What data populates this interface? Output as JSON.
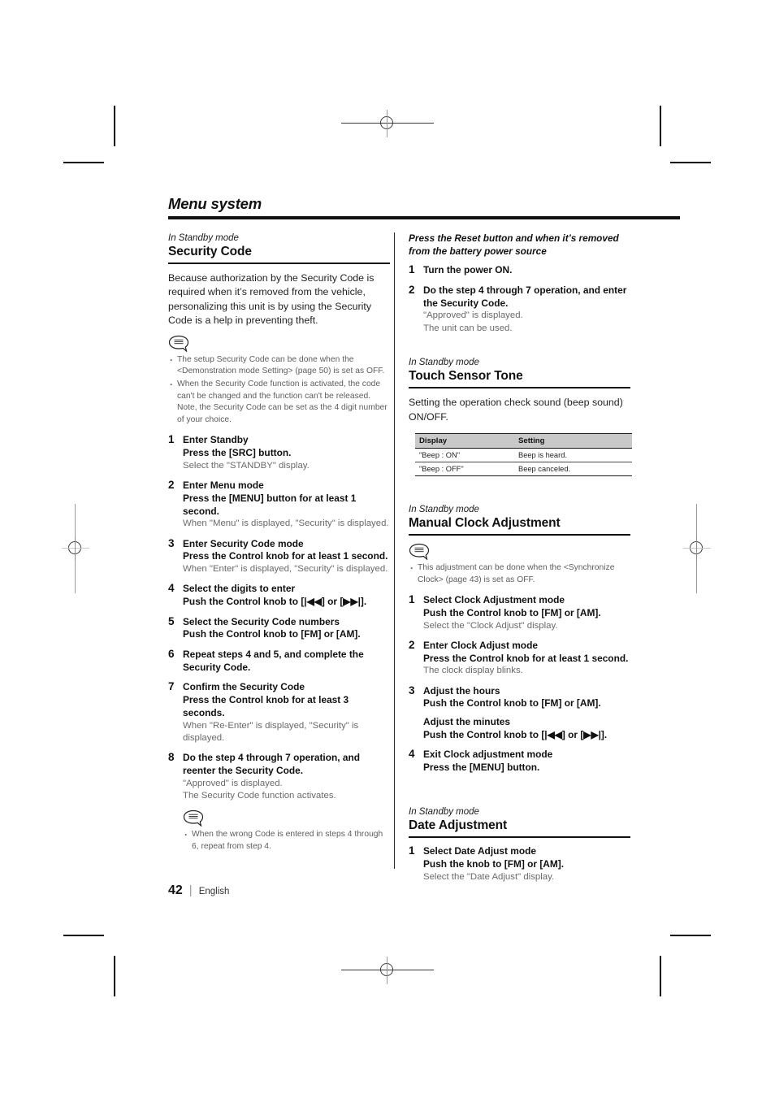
{
  "document": {
    "running_head": "Menu system",
    "footer": {
      "page_number": "42",
      "separator": "|",
      "language": "English"
    }
  },
  "left_column": {
    "eyebrow": "In Standby mode",
    "heading": "Security Code",
    "intro": "Because authorization by the Security Code is required when it’s removed from the vehicle, personalizing this unit is by using the Security Code is a help in preventing theft.",
    "note_icon": "note-bubble-icon",
    "notes": [
      "The setup Security Code can be done when the <Demonstration mode Setting> (page 50) is set as OFF.",
      "When the Security Code function is activated, the code can't be changed and the function can't be released. Note, the Security Code can be set as the 4 digit number of your choice."
    ],
    "steps": [
      {
        "num": "1",
        "title": "Enter Standby",
        "action": "Press the [SRC] button.",
        "note": "Select the \"STANDBY\" display."
      },
      {
        "num": "2",
        "title": "Enter Menu mode",
        "action": "Press the [MENU] button for at least 1 second.",
        "note": "When \"Menu\" is displayed, \"Security\" is displayed."
      },
      {
        "num": "3",
        "title": "Enter Security Code mode",
        "action": "Press the Control knob for at least 1 second.",
        "note": "When \"Enter\" is displayed, \"Security\" is displayed."
      },
      {
        "num": "4",
        "title": "Select the digits to enter",
        "action": "Push the Control knob to [|◀◀] or [▶▶|].",
        "note": ""
      },
      {
        "num": "5",
        "title": "Select the Security Code numbers",
        "action": "Push the Control knob to [FM] or [AM].",
        "note": ""
      },
      {
        "num": "6",
        "title": "Repeat steps 4 and 5, and complete the Security Code.",
        "action": "",
        "note": ""
      },
      {
        "num": "7",
        "title": "Confirm the Security Code",
        "action": "Press the Control knob for at least 3 seconds.",
        "note": "When \"Re-Enter\" is displayed, \"Security\" is displayed."
      },
      {
        "num": "8",
        "title": "Do the step 4 through 7 operation, and reenter the Security Code.",
        "action": "",
        "note": "\"Approved\" is displayed.\nThe Security Code function activates."
      }
    ],
    "bottom_note_icon": "note-bubble-icon",
    "bottom_notes": [
      "When the wrong Code is entered in steps 4 through 6, repeat from step 4."
    ]
  },
  "right_column": {
    "reset_lead": "Press the Reset button and when it’s removed from the battery power source",
    "reset_steps": [
      {
        "num": "1",
        "title": "Turn the power ON.",
        "action": "",
        "note": ""
      },
      {
        "num": "2",
        "title": "Do the step 4 through 7 operation, and enter the Security Code.",
        "action": "",
        "note": "\"Approved\" is displayed.\nThe unit can be used."
      }
    ],
    "touch_sensor": {
      "eyebrow": "In Standby mode",
      "heading": "Touch Sensor Tone",
      "intro": "Setting the operation check sound (beep sound) ON/OFF.",
      "table": {
        "headers": [
          "Display",
          "Setting"
        ],
        "rows": [
          [
            "\"Beep : ON\"",
            "Beep is heard."
          ],
          [
            "\"Beep : OFF\"",
            "Beep canceled."
          ]
        ]
      }
    },
    "manual_clock": {
      "eyebrow": "In Standby mode",
      "heading": "Manual Clock Adjustment",
      "note_icon": "note-bubble-icon",
      "notes": [
        "This adjustment can be done when the <Synchronize Clock> (page 43) is set as OFF."
      ],
      "steps": [
        {
          "num": "1",
          "title": "Select Clock Adjustment mode",
          "action": "Push the Control knob to [FM] or [AM].",
          "note": "Select the \"Clock Adjust\" display."
        },
        {
          "num": "2",
          "title": "Enter Clock Adjust mode",
          "action": "Press the Control knob for at least 1 second.",
          "note": "The clock display blinks."
        },
        {
          "num": "3",
          "title": "Adjust the hours",
          "action": "Push the Control knob to [FM] or [AM].",
          "note": "",
          "extra_title": "Adjust the minutes",
          "extra_action": "Push the Control knob to [|◀◀] or [▶▶|]."
        },
        {
          "num": "4",
          "title": "Exit Clock adjustment mode",
          "action": "Press the [MENU] button.",
          "note": ""
        }
      ]
    },
    "date_adjustment": {
      "eyebrow": "In Standby mode",
      "heading": "Date Adjustment",
      "steps": [
        {
          "num": "1",
          "title": "Select Date Adjust mode",
          "action": "Push the knob to [FM] or [AM].",
          "note": "Select the \"Date Adjust\" display."
        }
      ]
    }
  }
}
